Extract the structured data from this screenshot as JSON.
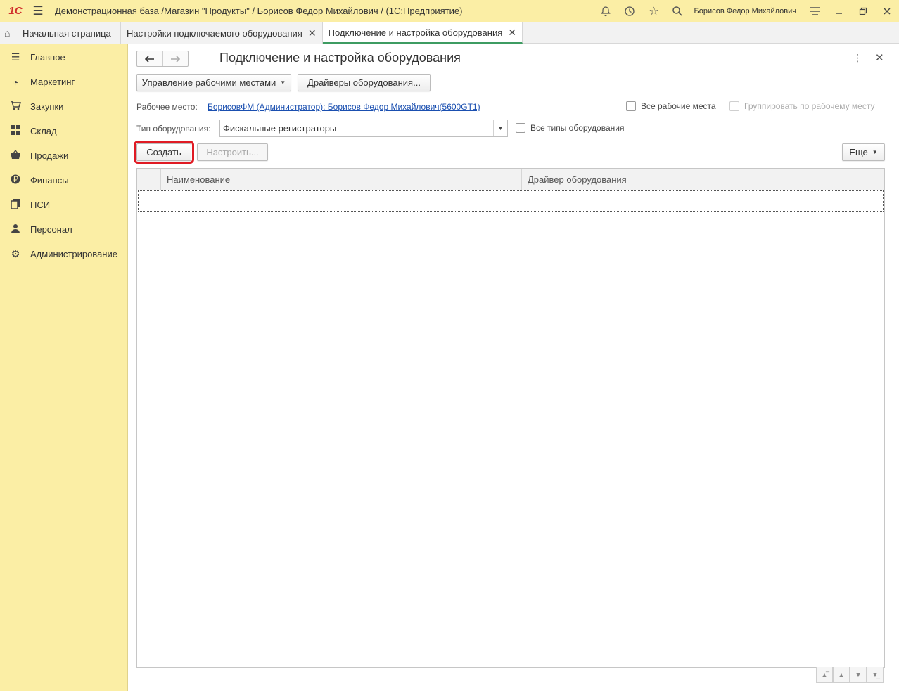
{
  "titlebar": {
    "logo": "1С",
    "title": "Демонстрационная база /Магазин \"Продукты\" / Борисов Федор Михайлович /  (1С:Предприятие)",
    "user": "Борисов Федор Михайлович"
  },
  "tabs": [
    {
      "label": "Начальная страница"
    },
    {
      "label": "Настройки подключаемого оборудования"
    },
    {
      "label": "Подключение и настройка оборудования"
    }
  ],
  "sidebar": {
    "items": [
      {
        "label": "Главное",
        "icon": "menu-lines-icon"
      },
      {
        "label": "Маркетинг",
        "icon": "pie-chart-icon"
      },
      {
        "label": "Закупки",
        "icon": "cart-icon"
      },
      {
        "label": "Склад",
        "icon": "grid-icon"
      },
      {
        "label": "Продажи",
        "icon": "basket-icon"
      },
      {
        "label": "Финансы",
        "icon": "ruble-icon"
      },
      {
        "label": "НСИ",
        "icon": "documents-icon"
      },
      {
        "label": "Персонал",
        "icon": "person-icon"
      },
      {
        "label": "Администрирование",
        "icon": "gear-icon"
      }
    ]
  },
  "form": {
    "title": "Подключение и настройка оборудования",
    "manage_workplaces": "Управление рабочими местами",
    "drivers": "Драйверы оборудования...",
    "workplace_label": "Рабочее место:",
    "workplace_value": "БорисовФМ (Администратор): Борисов Федор Михайлович(5600GT1)",
    "all_workplaces": "Все рабочие места",
    "group_by_workplace": "Группировать по рабочему месту",
    "equipment_type_label": "Тип оборудования:",
    "equipment_type_value": "Фискальные регистраторы",
    "all_equipment_types": "Все типы оборудования",
    "create": "Создать",
    "configure": "Настроить...",
    "more": "Еще"
  },
  "table": {
    "columns": [
      "Наименование",
      "Драйвер оборудования"
    ],
    "rows": []
  }
}
